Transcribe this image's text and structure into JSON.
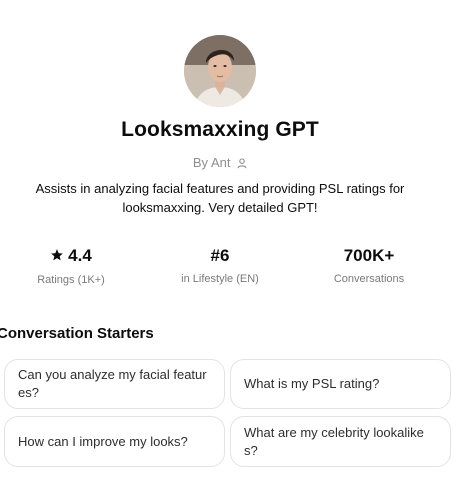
{
  "gpt": {
    "title": "Looksmaxxing GPT",
    "author": "By Ant",
    "description": "Assists in analyzing facial features and providing PSL ratings for looksmaxxing. Very detailed GPT!"
  },
  "stats": [
    {
      "value": "4.4",
      "label": "Ratings (1K+)",
      "icon": "star-icon"
    },
    {
      "value": "#6",
      "label": "in Lifestyle (EN)"
    },
    {
      "value": "700K+",
      "label": "Conversations"
    }
  ],
  "starters": {
    "title": "Conversation Starters",
    "items": [
      "Can you analyze my facial features?",
      "What is my PSL rating?",
      "How can I improve my looks?",
      "What are my celebrity lookalikes?"
    ]
  }
}
